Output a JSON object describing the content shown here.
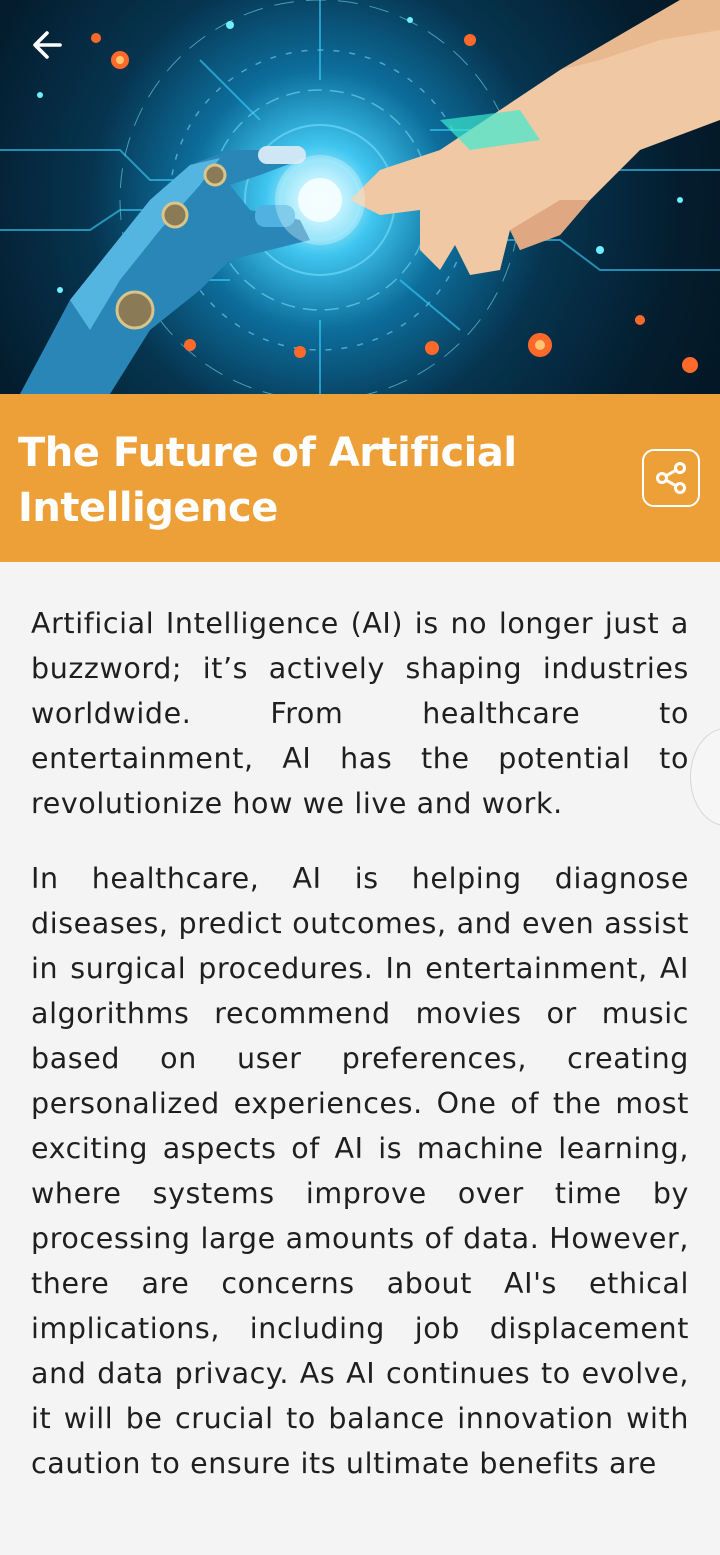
{
  "header": {
    "back_icon": "arrow-left-icon",
    "hero_image_description_icon": "ai-robot-human-hand-image"
  },
  "title_bar": {
    "title": "The Future of Artificial Intelligence",
    "share_icon": "share-icon",
    "background_color": "#eda038"
  },
  "article": {
    "paragraphs": [
      "Artificial Intelligence (AI) is no longer just a buzzword; it’s actively shaping industries worldwide. From healthcare to entertainment, AI has the potential to revolutionize how we live and work.",
      "In healthcare, AI is helping diagnose diseases, predict outcomes, and even assist in surgical procedures. In entertainment, AI algorithms recommend movies or music based on user preferences, creating personalized experiences. One of the most exciting aspects of AI is machine learning, where systems improve over time by processing large amounts of data. However, there are concerns about AI's ethical implications, including job displacement and data privacy. As AI continues to evolve, it will be crucial to balance innovation with caution to ensure its ultimate benefits are"
    ]
  }
}
